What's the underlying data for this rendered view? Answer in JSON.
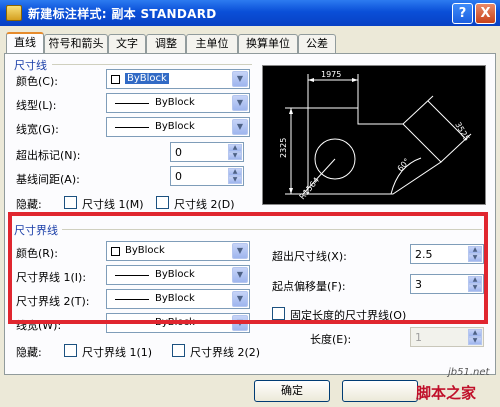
{
  "window": {
    "title": "新建标注样式: 副本 STANDARD",
    "help_label": "?",
    "close_label": "X"
  },
  "tabs": [
    "直线",
    "符号和箭头",
    "文字",
    "调整",
    "主单位",
    "换算单位",
    "公差"
  ],
  "dim_lines": {
    "group_title": "尺寸线",
    "color_label": "颜色(C):",
    "color_value": "ByBlock",
    "linetype_label": "线型(L):",
    "linetype_value": "ByBlock",
    "lineweight_label": "线宽(G):",
    "lineweight_value": "ByBlock",
    "extend_ticks_label": "超出标记(N):",
    "extend_ticks_value": "0",
    "baseline_spacing_label": "基线间距(A):",
    "baseline_spacing_value": "0",
    "suppress_label": "隐藏:",
    "suppress1_label": "尺寸线 1(M)",
    "suppress2_label": "尺寸线 2(D)"
  },
  "preview": {
    "dim_top": "1975",
    "dim_left": "2325",
    "dim_right": "3525",
    "dim_angle": "60°",
    "dim_radius": "R1564"
  },
  "ext_lines": {
    "group_title": "尺寸界线",
    "color_label": "颜色(R):",
    "color_value": "ByBlock",
    "linetype1_label": "尺寸界线 1(I):",
    "linetype1_value": "ByBlock",
    "linetype2_label": "尺寸界线 2(T):",
    "linetype2_value": "ByBlock",
    "lineweight_label": "线宽(W):",
    "lineweight_value": "ByBlock",
    "extend_label": "超出尺寸线(X):",
    "extend_value": "2.5",
    "offset_label": "起点偏移量(F):",
    "offset_value": "3",
    "fixed_length_label": "固定长度的尺寸界线(O)",
    "length_label": "长度(E):",
    "length_value": "1",
    "suppress_label": "隐藏:",
    "suppress1_label": "尺寸界线 1(1)",
    "suppress2_label": "尺寸界线 2(2)"
  },
  "buttons": {
    "ok": "确定"
  },
  "watermark": {
    "site": "jb51.net",
    "brand": "脚本之家"
  }
}
